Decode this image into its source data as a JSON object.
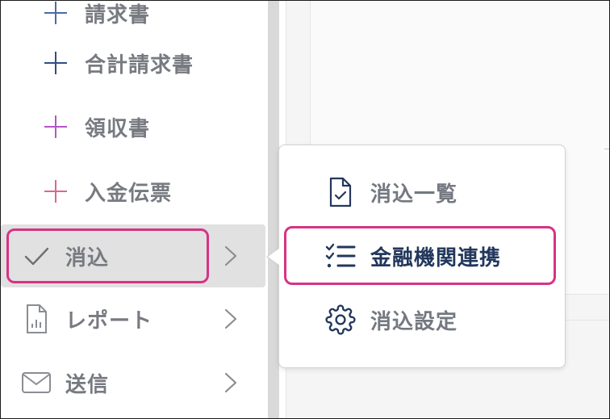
{
  "sidebar": {
    "sub_items": [
      {
        "label": "請求書",
        "color": "#4b6aa8"
      },
      {
        "label": "合計請求書",
        "color": "#2f4f86"
      },
      {
        "label": "領収書",
        "color": "#b455c9"
      },
      {
        "label": "入金伝票",
        "color": "#d86a8e"
      }
    ],
    "nav_items": [
      {
        "label": "消込",
        "icon": "check-icon",
        "active": true
      },
      {
        "label": "レポート",
        "icon": "report-icon",
        "active": false
      },
      {
        "label": "送信",
        "icon": "mail-icon",
        "active": false
      }
    ]
  },
  "popover": {
    "items": [
      {
        "label": "消込一覧",
        "icon": "document-check-icon",
        "selected": false
      },
      {
        "label": "金融機関連携",
        "icon": "checklist-icon",
        "selected": true
      },
      {
        "label": "消込設定",
        "icon": "gear-icon",
        "selected": false
      }
    ]
  },
  "colors": {
    "highlight": "#d63384",
    "active_background": "#e1e1e1",
    "navy": "#23375c",
    "muted_text": "#777a80"
  }
}
